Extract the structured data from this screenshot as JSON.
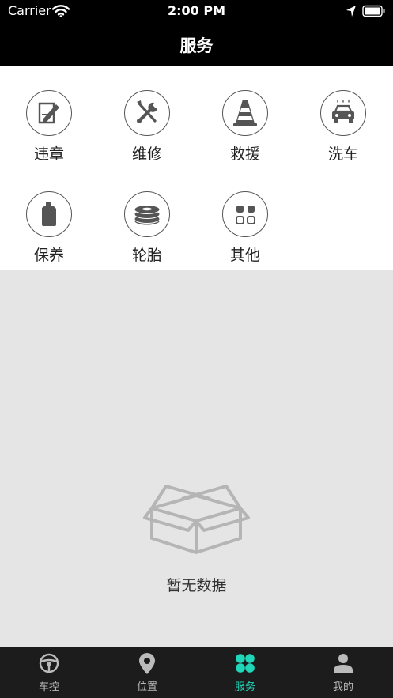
{
  "status_bar": {
    "carrier": "Carrier",
    "time": "2:00 PM"
  },
  "header": {
    "title": "服务"
  },
  "services": [
    {
      "label": "违章",
      "icon": "violation-edit-icon"
    },
    {
      "label": "维修",
      "icon": "repair-tools-icon"
    },
    {
      "label": "救援",
      "icon": "traffic-cone-icon"
    },
    {
      "label": "洗车",
      "icon": "car-wash-icon"
    },
    {
      "label": "保养",
      "icon": "oil-can-icon"
    },
    {
      "label": "轮胎",
      "icon": "tire-stack-icon"
    },
    {
      "label": "其他",
      "icon": "grid-apps-icon"
    }
  ],
  "empty_state": {
    "text": "暂无数据",
    "icon": "empty-box-icon"
  },
  "tabs": [
    {
      "label": "车控",
      "icon": "steering-wheel-icon",
      "active": false
    },
    {
      "label": "位置",
      "icon": "location-pin-icon",
      "active": false
    },
    {
      "label": "服务",
      "icon": "clover-grid-icon",
      "active": true
    },
    {
      "label": "我的",
      "icon": "person-icon",
      "active": false
    }
  ],
  "colors": {
    "accent": "#1fd6b9",
    "header_bg": "#000000",
    "tabbar_bg": "#1c1c1c",
    "content_bg": "#e5e5e5"
  }
}
